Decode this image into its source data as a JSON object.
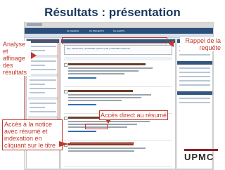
{
  "slide": {
    "title": "Résultats : présentation"
  },
  "app": {
    "nav_items": [
      "My SEARCH",
      "My PROJECTS",
      "My ALERTS"
    ],
    "search_text": "Key: (refinement) (\"embedded systems\") OR (\"embedded systems\")"
  },
  "callouts": {
    "left": "Analyse et affinage des résultats",
    "right": "Rappel de la requête",
    "middle": "Accès direct au résumé",
    "bottom": "Accès à la notice avec résumé et indexation en cliquant sur le titre"
  },
  "logo": {
    "text": "UPMC"
  },
  "colors": {
    "title": "#17375e",
    "callout": "#c0392b",
    "app_nav": "#2b4e7a"
  }
}
